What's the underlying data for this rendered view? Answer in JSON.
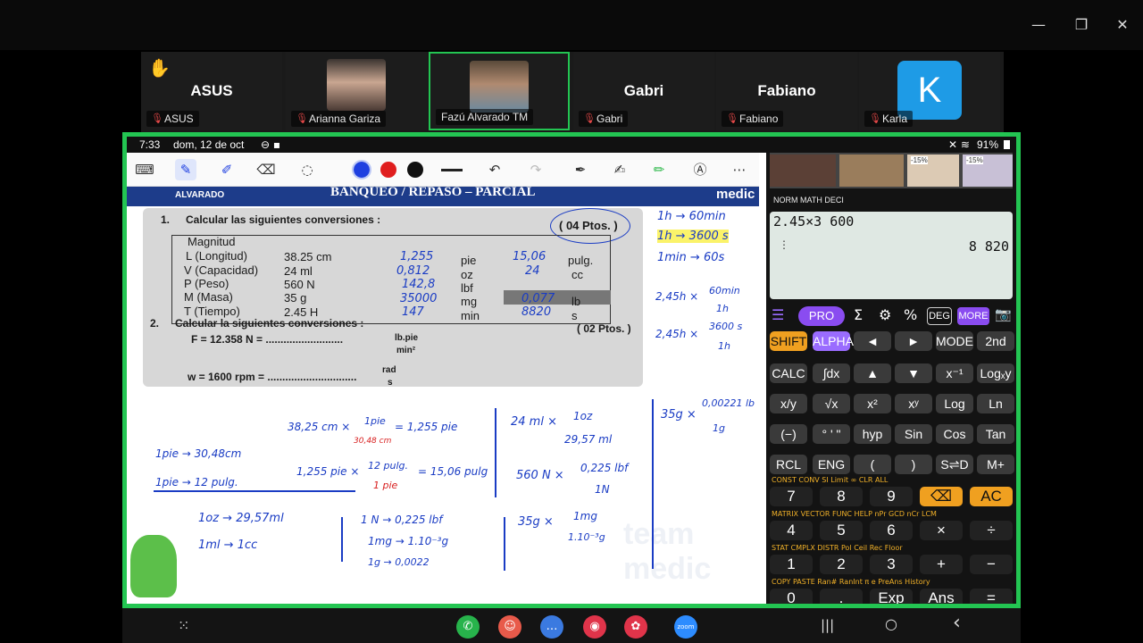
{
  "window": {
    "minimize": "—",
    "restore": "❐",
    "close": "✕"
  },
  "participants": [
    {
      "big": "ASUS",
      "caption": "ASUS",
      "hand": "✋"
    },
    {
      "big": "",
      "caption": "Arianna Gariza"
    },
    {
      "big": "",
      "caption": "Fazú Alvarado TM"
    },
    {
      "big": "Gabri",
      "caption": "Gabri"
    },
    {
      "big": "Fabiano",
      "caption": "Fabiano"
    },
    {
      "big": "K",
      "caption": "Karla"
    }
  ],
  "status": {
    "time": "7:33",
    "date": "dom, 12 de oct",
    "battery": "91%"
  },
  "toolbar": {
    "colors": [
      "#1e3fe0",
      "#e01e1e",
      "#111111"
    ]
  },
  "worksheet": {
    "brand_left": "ALVARADO",
    "header": "BANQUEO / REPASO – PARCIAL",
    "brand_right": "medic",
    "q1": "1.",
    "q1_title": "Calcular las siguientes conversiones :",
    "q1_points": "( 04 Ptos. )",
    "table_header": "Magnitud",
    "rows": [
      {
        "mag": "L  (Longitud)",
        "val": "38.25  cm",
        "unit": "pie",
        "unit2": "pulg."
      },
      {
        "mag": "V (Capacidad)",
        "val": "24  ml",
        "unit": "oz",
        "unit2": "cc"
      },
      {
        "mag": "P  (Peso)",
        "val": "560 N",
        "unit": "lbf",
        "unit2": ""
      },
      {
        "mag": "M (Masa)",
        "val": "35 g",
        "unit": "mg",
        "unit2": "lb"
      },
      {
        "mag": "T  (Tiempo)",
        "val": "2.45 H",
        "unit": "min",
        "unit2": "s"
      }
    ],
    "answers": [
      "1,255",
      "0,812",
      "142,8",
      "35000",
      "147"
    ],
    "answers2": [
      "15,06",
      "24",
      "",
      "0,077",
      "8820"
    ],
    "q2": "2.",
    "q2_title": "Calcular la siguientes conversiones :",
    "q2_points": "( 02 Ptos. )",
    "f_line": "F = 12.358 N = ..........................",
    "f_unit_top": "lb.pie",
    "f_unit_bot": "min²",
    "w_line": "w = 1600 rpm = ..............................",
    "w_unit_top": "rad",
    "w_unit_bot": "s"
  },
  "handwriting": {
    "r1": "1h  → 60min",
    "r2": "1h  → 3600 s",
    "r3": "1min → 60s",
    "c1a": "2,45h ×",
    "c1b": "60min",
    "c1c": "1h",
    "c2a": "2,45h ×",
    "c2b": "3600 s",
    "c2c": "1h",
    "l1": "1pie → 30,48cm",
    "l2": "1pie → 12 pulg.",
    "m1": "38,25 cm ×",
    "m1n": "1pie",
    "m1d": "30,48 cm",
    "m1r": "= 1,255 pie",
    "m2": "1,255 pie ×",
    "m2n": "12 pulg.",
    "m2d": "1 pie",
    "m2r": "= 15,06 pulg",
    "v1": "24 ml ×",
    "v1n": "1oz",
    "v1d": "29,57 ml",
    "p1": "560 N ×",
    "p1n": "0,225 lbf",
    "p1d": "1N",
    "g1": "35g ×",
    "g1n": "0,00221 lb",
    "g1d": "1g",
    "o1": "1oz  → 29,57ml",
    "o2": "1ml  → 1cc",
    "n1": "1 N  → 0,225 lbf",
    "n2": "1mg → 1.10⁻³g",
    "n3": "1g  → 0,0022",
    "mg1": "35g ×",
    "mg1n": "1mg",
    "mg1d": "1.10⁻³g",
    "watermark": "team medic"
  },
  "calculator": {
    "modes": "NORM  MATH  DECI",
    "input": "2.45×3 600",
    "result": "8 820",
    "pro": "PRO",
    "deg": "DEG",
    "more": "MORE",
    "rows": [
      [
        "SHIFT",
        "ALPHA",
        "◄",
        "►",
        "MODE",
        "2nd"
      ],
      [
        "CALC",
        "∫dx",
        "▲",
        "▼",
        "x⁻¹",
        "Logₓy"
      ],
      [
        "x/y",
        "√x",
        "x²",
        "xʸ",
        "Log",
        "Ln"
      ],
      [
        "(−)",
        "° ' \"",
        "hyp",
        "Sin",
        "Cos",
        "Tan"
      ],
      [
        "RCL",
        "ENG",
        "(",
        ")",
        "S⇌D",
        "M+"
      ]
    ],
    "numrows": [
      [
        "7",
        "8",
        "9",
        "⌫",
        "AC"
      ],
      [
        "4",
        "5",
        "6",
        "×",
        "÷"
      ],
      [
        "1",
        "2",
        "3",
        "+",
        "−"
      ],
      [
        "0",
        ".",
        "Exp",
        "Ans",
        "="
      ]
    ],
    "subs": [
      "CONST   CONV  SI  Limit  ∞                CLR ALL",
      "MATRIX      VECTOR   FUNC HELP  nPr  GCD  nCr  LCM",
      "STAT        CMPLX        DISTR        Pol  Ceil   Rec  Floor",
      "COPY PASTE  Ran# RanInt   π      e       PreAns     History"
    ],
    "percent": [
      "-15%",
      "-15%"
    ]
  },
  "nav": {
    "apps": [
      "phone",
      "contacts",
      "messages",
      "camera",
      "flower",
      "zoom"
    ],
    "zoom": "zoom",
    "recents": "|||",
    "home": "○",
    "back": "‹"
  }
}
